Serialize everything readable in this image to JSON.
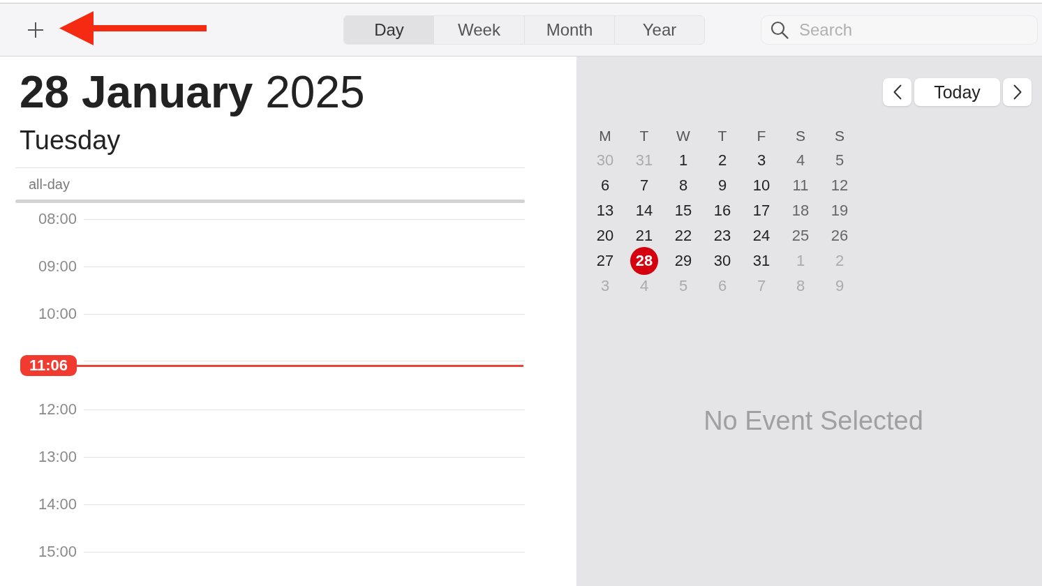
{
  "toolbar": {
    "view_tabs": [
      {
        "label": "Day",
        "selected": true
      },
      {
        "label": "Week",
        "selected": false
      },
      {
        "label": "Month",
        "selected": false
      },
      {
        "label": "Year",
        "selected": false
      }
    ],
    "search": {
      "placeholder": "Search"
    }
  },
  "day_view": {
    "title": "**28 January** 2025",
    "weekday": "Tuesday",
    "all_day_label": "all-day",
    "timeline": [
      {
        "kind": "hour",
        "label": "08:00"
      },
      {
        "kind": "hour",
        "label": "09:00"
      },
      {
        "kind": "hour",
        "label": "10:00"
      },
      {
        "kind": "now",
        "label": "11:06"
      },
      {
        "kind": "hour",
        "label": "12:00"
      },
      {
        "kind": "hour",
        "label": "13:00"
      },
      {
        "kind": "hour",
        "label": "14:00"
      },
      {
        "kind": "hour",
        "label": "15:00"
      }
    ]
  },
  "navigator": {
    "today_button": "Today"
  },
  "mini_calendar": {
    "weekdays": [
      "M",
      "T",
      "W",
      "T",
      "F",
      "S",
      "S"
    ],
    "weeks": [
      [
        {
          "label": "30",
          "in_month": false,
          "selected": false
        },
        {
          "label": "31",
          "in_month": false,
          "selected": false
        },
        {
          "label": "1",
          "in_month": true,
          "selected": false
        },
        {
          "label": "2",
          "in_month": true,
          "selected": false
        },
        {
          "label": "3",
          "in_month": true,
          "selected": false
        },
        {
          "label": "4",
          "in_month": true,
          "selected": false
        },
        {
          "label": "5",
          "in_month": true,
          "selected": false
        }
      ],
      [
        {
          "label": "6",
          "in_month": true,
          "selected": false
        },
        {
          "label": "7",
          "in_month": true,
          "selected": false
        },
        {
          "label": "8",
          "in_month": true,
          "selected": false
        },
        {
          "label": "9",
          "in_month": true,
          "selected": false
        },
        {
          "label": "10",
          "in_month": true,
          "selected": false
        },
        {
          "label": "11",
          "in_month": true,
          "selected": false
        },
        {
          "label": "12",
          "in_month": true,
          "selected": false
        }
      ],
      [
        {
          "label": "13",
          "in_month": true,
          "selected": false
        },
        {
          "label": "14",
          "in_month": true,
          "selected": false
        },
        {
          "label": "15",
          "in_month": true,
          "selected": false
        },
        {
          "label": "16",
          "in_month": true,
          "selected": false
        },
        {
          "label": "17",
          "in_month": true,
          "selected": false
        },
        {
          "label": "18",
          "in_month": true,
          "selected": false
        },
        {
          "label": "19",
          "in_month": true,
          "selected": false
        }
      ],
      [
        {
          "label": "20",
          "in_month": true,
          "selected": false
        },
        {
          "label": "21",
          "in_month": true,
          "selected": false
        },
        {
          "label": "22",
          "in_month": true,
          "selected": false
        },
        {
          "label": "23",
          "in_month": true,
          "selected": false
        },
        {
          "label": "24",
          "in_month": true,
          "selected": false
        },
        {
          "label": "25",
          "in_month": true,
          "selected": false
        },
        {
          "label": "26",
          "in_month": true,
          "selected": false
        }
      ],
      [
        {
          "label": "27",
          "in_month": true,
          "selected": false
        },
        {
          "label": "28",
          "in_month": true,
          "selected": true
        },
        {
          "label": "29",
          "in_month": true,
          "selected": false
        },
        {
          "label": "30",
          "in_month": true,
          "selected": false
        },
        {
          "label": "31",
          "in_month": true,
          "selected": false
        },
        {
          "label": "1",
          "in_month": false,
          "selected": false
        },
        {
          "label": "2",
          "in_month": false,
          "selected": false
        }
      ],
      [
        {
          "label": "3",
          "in_month": false,
          "selected": false
        },
        {
          "label": "4",
          "in_month": false,
          "selected": false
        },
        {
          "label": "5",
          "in_month": false,
          "selected": false
        },
        {
          "label": "6",
          "in_month": false,
          "selected": false
        },
        {
          "label": "7",
          "in_month": false,
          "selected": false
        },
        {
          "label": "8",
          "in_month": false,
          "selected": false
        },
        {
          "label": "9",
          "in_month": false,
          "selected": false
        }
      ]
    ]
  },
  "detail": {
    "message": "No Event Selected"
  }
}
